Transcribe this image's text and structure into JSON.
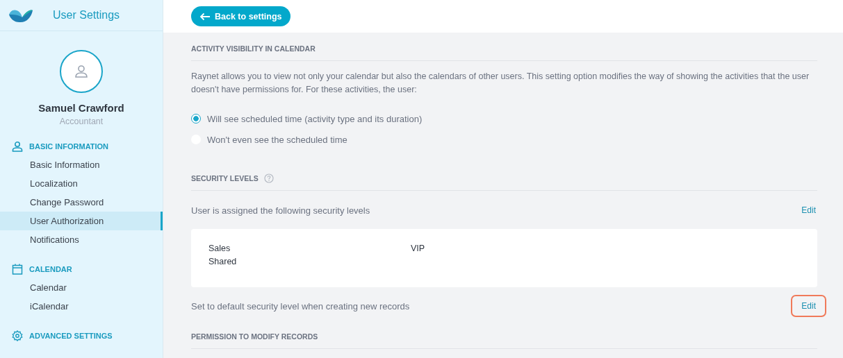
{
  "app_title": "User Settings",
  "profile": {
    "name": "Samuel Crawford",
    "role": "Accountant"
  },
  "sidebar": {
    "sections": [
      {
        "title": "BASIC INFORMATION",
        "kind": "person",
        "items": [
          {
            "label": "Basic Information",
            "selected": false
          },
          {
            "label": "Localization",
            "selected": false
          },
          {
            "label": "Change Password",
            "selected": false
          },
          {
            "label": "User Authorization",
            "selected": true
          },
          {
            "label": "Notifications",
            "selected": false
          }
        ]
      },
      {
        "title": "CALENDAR",
        "kind": "calendar",
        "items": [
          {
            "label": "Calendar",
            "selected": false
          },
          {
            "label": "iCalendar",
            "selected": false
          }
        ]
      },
      {
        "title": "ADVANCED SETTINGS",
        "kind": "gear"
      }
    ]
  },
  "back_button": "Back to settings",
  "activity_visibility": {
    "heading": "ACTIVITY VISIBILITY IN CALENDAR",
    "description": "Raynet allows you to view not only your calendar but also the calendars of other users. This setting option modifies the way of showing the activities that the user doesn't have permissions for. For these activities, the user:",
    "options": [
      {
        "label": "Will see scheduled time (activity type and its duration)",
        "selected": true
      },
      {
        "label": "Won't even see the scheduled time",
        "selected": false
      }
    ]
  },
  "security_levels": {
    "heading": "SECURITY LEVELS",
    "assigned_label": "User is assigned the following security levels",
    "assigned_edit": {
      "label": "Edit",
      "highlighted": false
    },
    "levels": [
      "Sales",
      "VIP",
      "Shared"
    ],
    "default_label": "Set to default security level when creating new records",
    "default_edit": {
      "label": "Edit",
      "highlighted": true
    }
  },
  "permission": {
    "heading": "PERMISSION TO MODIFY RECORDS"
  }
}
